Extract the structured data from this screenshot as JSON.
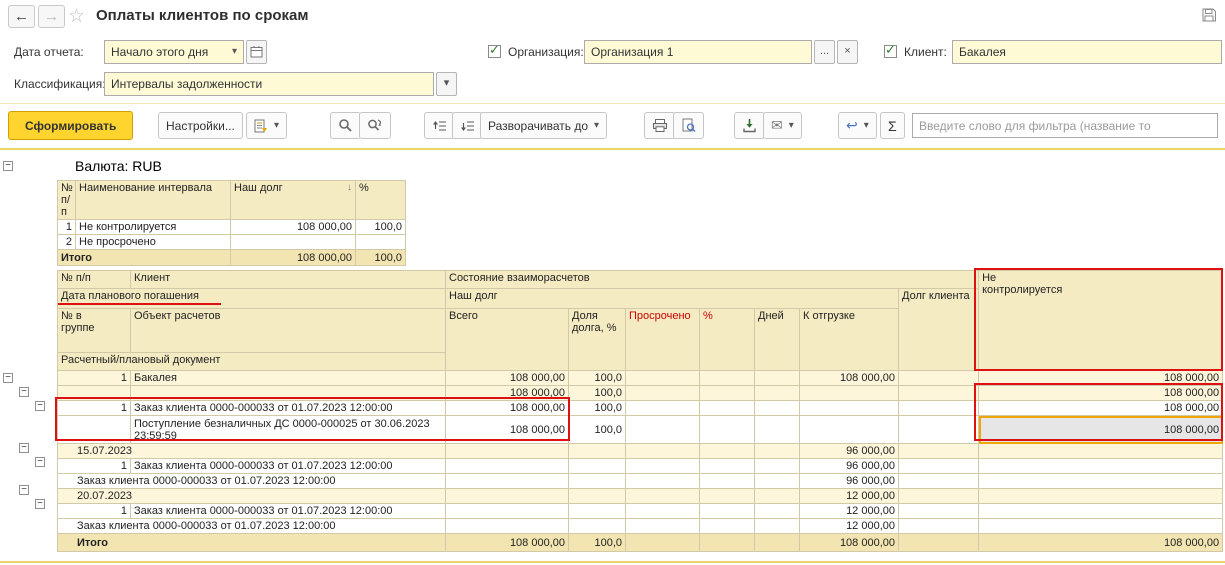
{
  "titlebar": {
    "title": "Оплаты клиентов по срокам"
  },
  "icons": {
    "back": "←",
    "forward": "→",
    "favorite_star": "☆",
    "dropdown": "▾",
    "sigma": "Σ",
    "envelope": "✉",
    "link_arrow": "↩",
    "sort_descending": "↓",
    "ellipsis": "...",
    "clear": "×",
    "collapse_minus": "−",
    "check": "✓"
  },
  "filters": {
    "date_label": "Дата отчета:",
    "date_value": "Начало этого дня",
    "classification_label": "Классификация:",
    "classification_value": "Интервалы задолженности",
    "org_label": "Организация:",
    "org_value": "Организация 1",
    "client_label": "Клиент:",
    "client_value": "Бакалея"
  },
  "toolbar": {
    "generate": "Сформировать",
    "settings": "Настройки...",
    "expand_to": "Разворачивать до",
    "filter_placeholder": "Введите слово для фильтра (название то"
  },
  "report": {
    "currency_header": "Валюта: RUB",
    "intervals": {
      "headers": {
        "num": "№ п/п",
        "name": "Наименование интервала",
        "our_debt": "Наш долг",
        "pct": "%"
      },
      "rows": [
        {
          "num": "1",
          "name": "Не контролируется",
          "our_debt": "108 000,00",
          "pct": "100,0"
        },
        {
          "num": "2",
          "name": "Не просрочено"
        }
      ],
      "total": {
        "label": "Итого",
        "our_debt": "108 000,00",
        "pct": "100,0"
      }
    },
    "main": {
      "headers": {
        "num": "№ п/п",
        "client": "Клиент",
        "state": "Состояние взаиморасчетов",
        "not_controlled": "Не контролируется",
        "planned_date": "Дата планового погашения",
        "our_debt": "Наш долг",
        "client_debt": "Долг клиента",
        "num_in_group": "№ в группе",
        "object": "Объект расчетов",
        "total": "Всего",
        "share": "Доля долга, %",
        "overdue": "Просрочено",
        "pct": "%",
        "days": "Дней",
        "to_ship": "К отгрузке",
        "doc": "Расчетный/плановый документ"
      },
      "rows": [
        {
          "num": "1",
          "name": "Бакалея",
          "total": "108 000,00",
          "share": "100,0",
          "to_ship": "108 000,00",
          "not_controlled": "108 000,00"
        },
        {
          "total": "108 000,00",
          "share": "100,0",
          "not_controlled": "108 000,00"
        },
        {
          "num": "1",
          "name": "Заказ клиента 0000-000033 от 01.07.2023 12:00:00",
          "total": "108 000,00",
          "share": "100,0",
          "not_controlled": "108 000,00"
        },
        {
          "name": "Поступление безналичных ДС 0000-000025 от 30.06.2023 23:59:59",
          "total": "108 000,00",
          "share": "100,0",
          "not_controlled": "108 000,00"
        },
        {
          "name": "15.07.2023",
          "to_ship": "96 000,00"
        },
        {
          "num": "1",
          "name": "Заказ клиента 0000-000033 от 01.07.2023 12:00:00",
          "to_ship": "96 000,00"
        },
        {
          "name": "Заказ клиента 0000-000033 от 01.07.2023 12:00:00",
          "to_ship": "96 000,00"
        },
        {
          "name": "20.07.2023",
          "to_ship": "12 000,00"
        },
        {
          "num": "1",
          "name": "Заказ клиента 0000-000033 от 01.07.2023 12:00:00",
          "to_ship": "12 000,00"
        },
        {
          "name": "Заказ клиента 0000-000033 от 01.07.2023 12:00:00",
          "to_ship": "12 000,00"
        }
      ],
      "total_row": {
        "label": "Итого",
        "total": "108 000,00",
        "share": "100,0",
        "to_ship": "108 000,00",
        "not_controlled": "108 000,00"
      }
    }
  },
  "colors": {
    "accent_yellow": "#ffd42e",
    "header_beige": "#f5ebc3",
    "group_beige": "#fdf6da",
    "total_beige": "#f2e5b2",
    "grid_border": "#d2c9a8",
    "annotation_red": "#dd1111",
    "selection_orange": "#eda70a",
    "overdue_red": "#cc0000"
  }
}
